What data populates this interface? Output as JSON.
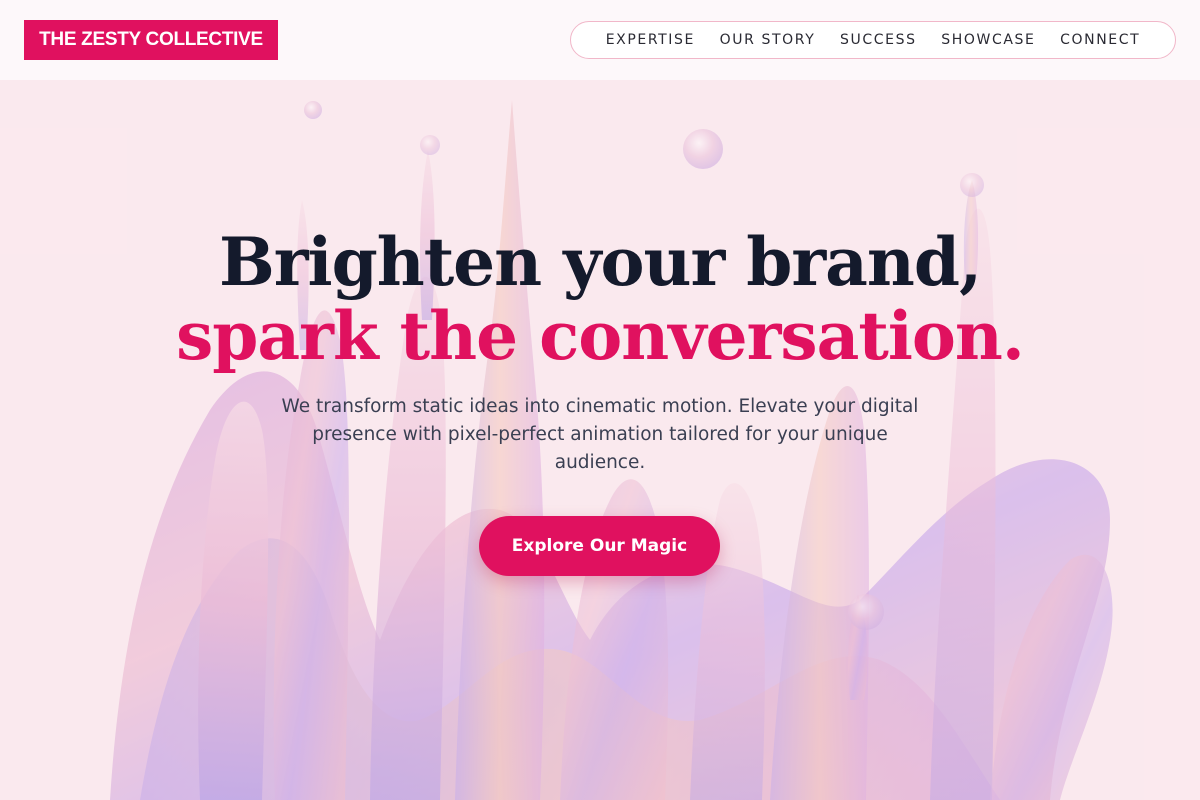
{
  "header": {
    "logo_text": "THE ZESTY COLLECTIVE",
    "nav": [
      {
        "label": "EXPERTISE"
      },
      {
        "label": "OUR STORY"
      },
      {
        "label": "SUCCESS"
      },
      {
        "label": "SHOWCASE"
      },
      {
        "label": "CONNECT"
      }
    ]
  },
  "hero": {
    "headline_line1": "Brighten your brand,",
    "headline_line2": "spark the conversation.",
    "subtitle": "We transform static ideas into cinematic motion. Elevate your digital presence with pixel-perfect animation tailored for your unique audience.",
    "cta_label": "Explore Our Magic",
    "background_image": "iridescent-liquid-splash-illustration"
  },
  "colors": {
    "accent": "#e0115f",
    "headline_dark": "#141a2c",
    "page_background": "#fbe9ee",
    "header_background": "#fdf8fa",
    "nav_border": "#f1b7c9"
  }
}
